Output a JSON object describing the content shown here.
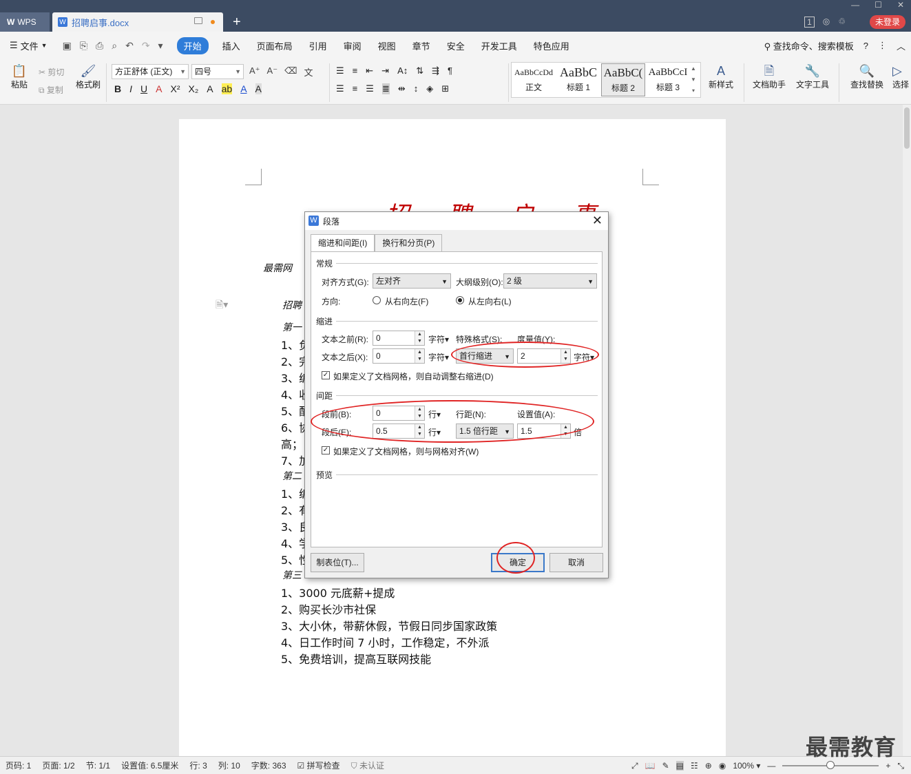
{
  "titlebar": {
    "app_tab": "WPS",
    "doc_tab": "招聘启事.docx",
    "unlogin": "未登录",
    "page_count_badge": "1"
  },
  "menubar": {
    "file": "文件",
    "items": [
      "开始",
      "插入",
      "页面布局",
      "引用",
      "审阅",
      "视图",
      "章节",
      "安全",
      "开发工具",
      "特色应用"
    ],
    "search": "查找命令、搜索模板"
  },
  "ribbon": {
    "paste": "粘贴",
    "cut": "剪切",
    "copy": "复制",
    "format_painter": "格式刷",
    "font_name": "方正舒体 (正文)",
    "font_size": "四号",
    "styles": [
      {
        "sample": "AaBbCcDd",
        "name": "正文"
      },
      {
        "sample": "AaBbC",
        "name": "标题 1"
      },
      {
        "sample": "AaBbC(",
        "name": "标题 2"
      },
      {
        "sample": "AaBbCcI",
        "name": "标题 3"
      }
    ],
    "new_style": "新样式",
    "doc_helper": "文档助手",
    "text_tools": "文字工具",
    "find_replace": "查找替换",
    "select": "选择"
  },
  "document": {
    "title": "招 聘 启 事",
    "company_line": "最需网",
    "job_line": "招聘",
    "section1": "第一",
    "lines_a": [
      "1、负",
      "2、完",
      "3、编",
      "4、收",
      "5、配",
      "6、协",
      "高；",
      "7、加"
    ],
    "section2": "第二",
    "lines_b": [
      "1、编",
      "2、有",
      "3、良",
      "4、学",
      "5、性"
    ],
    "section3": "第三",
    "lines_c": [
      "1、3000 元底薪+提成",
      "2、购买长沙市社保",
      "3、大小休，带薪休假，节假日同步国家政策",
      "4、日工作时间 7 小时，工作稳定，不外派",
      "5、免费培训，提高互联网技能"
    ]
  },
  "dialog": {
    "title": "段落",
    "tab_indent": "缩进和间距(I)",
    "tab_page": "换行和分页(P)",
    "general": "常规",
    "align_label": "对齐方式(G):",
    "align_value": "左对齐",
    "outline_label": "大纲级别(O):",
    "outline_value": "2 级",
    "direction_label": "方向:",
    "rtl": "从右向左(F)",
    "ltr": "从左向右(L)",
    "indent": "缩进",
    "before_text_label": "文本之前(R):",
    "before_text_value": "0",
    "after_text_label": "文本之后(X):",
    "after_text_value": "0",
    "unit_char": "字符",
    "special_label": "特殊格式(S):",
    "special_value": "首行缩进",
    "measure_label": "度量值(Y):",
    "measure_value": "2",
    "grid_indent_chk": "如果定义了文档网格，则自动调整右缩进(D)",
    "spacing": "间距",
    "before_label": "段前(B):",
    "before_value": "0",
    "after_label": "段后(E):",
    "after_value": "0.5",
    "unit_line": "行",
    "line_spacing_label": "行距(N):",
    "line_spacing_value": "1.5 倍行距",
    "setting_label": "设置值(A):",
    "setting_value": "1.5",
    "unit_times": "倍",
    "grid_align_chk": "如果定义了文档网格，则与网格对齐(W)",
    "preview": "预览",
    "tabs_btn": "制表位(T)...",
    "ok": "确定",
    "cancel": "取消"
  },
  "statusbar": {
    "page_num": "页码: 1",
    "pages": "页面: 1/2",
    "section": "节: 1/1",
    "setting": "设置值: 6.5厘米",
    "row": "行: 3",
    "col": "列: 10",
    "words": "字数: 363",
    "spell": "拼写检查",
    "auth": "未认证",
    "zoom": "100%"
  },
  "watermark": "最需教育"
}
